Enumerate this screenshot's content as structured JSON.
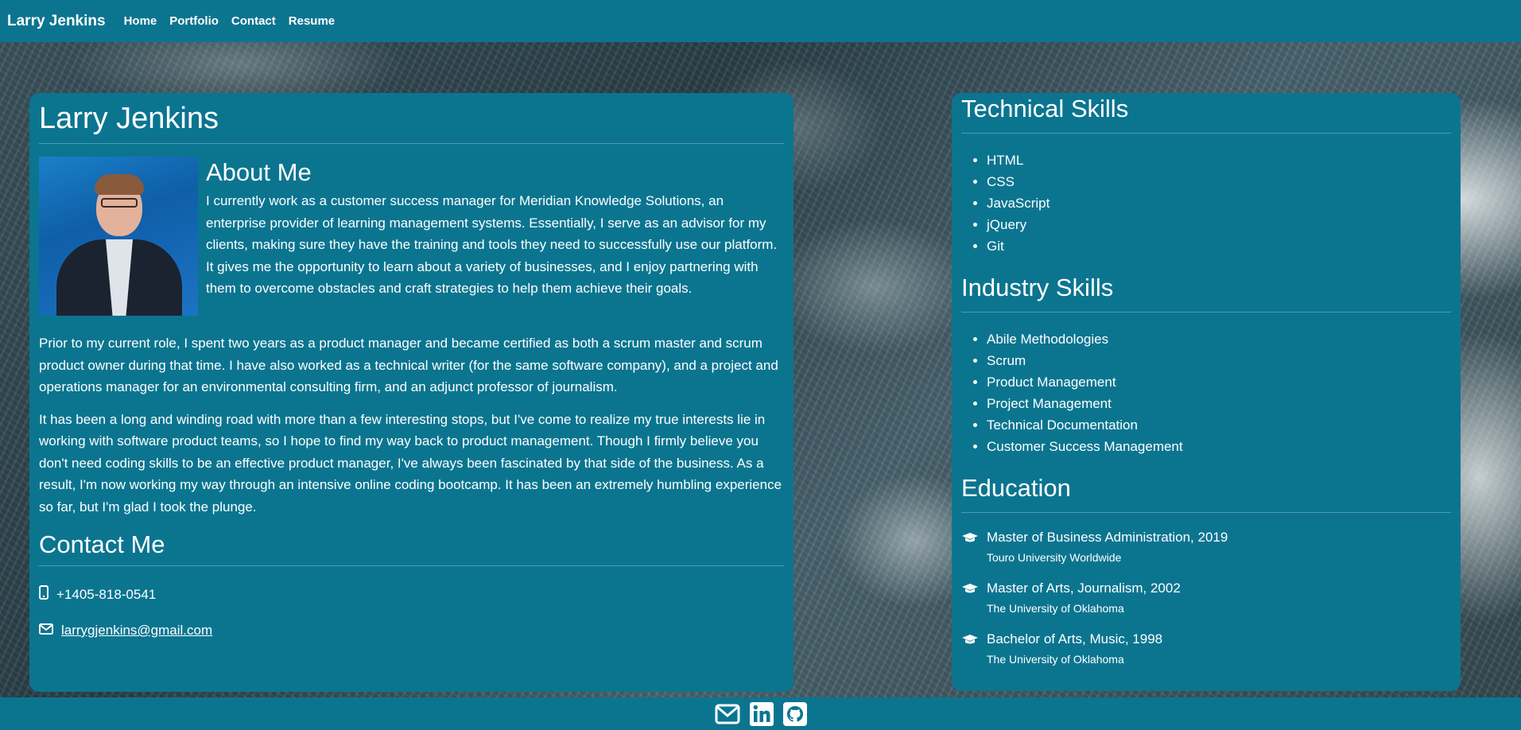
{
  "nav": {
    "brand": "Larry Jenkins",
    "links": [
      "Home",
      "Portfolio",
      "Contact",
      "Resume"
    ]
  },
  "profile": {
    "name": "Larry Jenkins",
    "about_title": "About Me",
    "about_paragraphs": [
      "I currently work as a customer success manager for Meridian Knowledge Solutions, an enterprise provider of learning management systems. Essentially, I serve as an advisor for my clients, making sure they have the training and tools they need to successfully use our platform. It gives me the opportunity to learn about a variety of businesses, and I enjoy partnering with them to overcome obstacles and craft strategies to help them achieve their goals.",
      "Prior to my current role, I spent two years as a product manager and became certified as both a scrum master and scrum product owner during that time. I have also worked as a technical writer (for the same software company), and a project and operations manager for an environmental consulting firm, and an adjunct professor of journalism.",
      "It has been a long and winding road with more than a few interesting stops, but I've come to realize my true interests lie in working with software product teams, so I hope to find my way back to product management. Though I firmly believe you don't need coding skills to be an effective product manager, I've always been fascinated by that side of the business. As a result, I'm now working my way through an intensive online coding bootcamp. It has been an extremely humbling experience so far, but I'm glad I took the plunge."
    ],
    "contact_title": "Contact Me",
    "phone": "+1405-818-0541",
    "phone_icon": "mobile-phone-icon",
    "email": "larrygjenkins@gmail.com",
    "email_icon": "envelope-icon"
  },
  "technical": {
    "title": "Technical Skills",
    "items": [
      "HTML",
      "CSS",
      "JavaScript",
      "jQuery",
      "Git"
    ]
  },
  "industry": {
    "title": "Industry Skills",
    "items": [
      "Abile Methodologies",
      "Scrum",
      "Product Management",
      "Project Management",
      "Technical Documentation",
      "Customer Success Management"
    ]
  },
  "education": {
    "title": "Education",
    "icon": "graduation-cap-icon",
    "items": [
      {
        "degree": "Master of Business Administration, 2019",
        "school": "Touro University Worldwide"
      },
      {
        "degree": "Master of Arts, Journalism, 2002",
        "school": "The University of Oklahoma"
      },
      {
        "degree": "Bachelor of Arts, Music, 1998",
        "school": "The University of Oklahoma"
      }
    ]
  },
  "footer": {
    "icons": [
      "envelope-icon",
      "linkedin-icon",
      "github-icon"
    ]
  },
  "colors": {
    "primary": "#0b7590",
    "text": "#ffffff"
  }
}
